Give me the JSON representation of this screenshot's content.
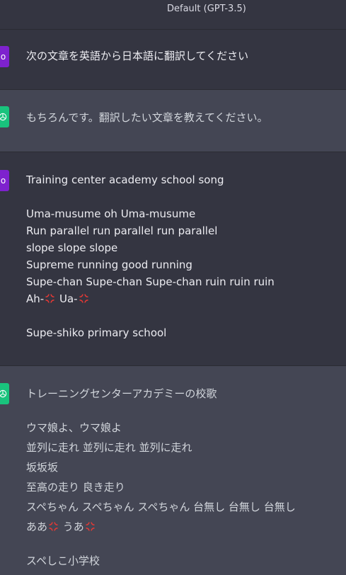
{
  "header": {
    "model_label": "Default (GPT-3.5)"
  },
  "messages": [
    {
      "role": "user",
      "avatar_text": "o",
      "lines": [
        "次の文章を英語から日本語に翻訳してください"
      ]
    },
    {
      "role": "assistant",
      "avatar_icon": "openai-logo-icon",
      "lines": [
        "もちろんです。翻訳したい文章を教えてください。"
      ]
    },
    {
      "role": "user",
      "avatar_text": "o",
      "lines": [
        "Training center academy school song",
        "Uma-musume oh Uma-musume",
        "Run parallel run parallel run parallel",
        "slope slope slope",
        "Supreme running good running",
        "Supe-chan Supe-chan Supe-chan ruin ruin ruin",
        {
          "a": "Ah-",
          "b": "Ua-"
        },
        "Supe-shiko primary school"
      ]
    },
    {
      "role": "assistant",
      "avatar_icon": "openai-logo-icon",
      "lines": [
        "トレーニングセンターアカデミーの校歌",
        "ウマ娘よ、ウマ娘よ",
        "並列に走れ 並列に走れ 並列に走れ",
        "坂坂坂",
        "至高の走り 良き走り",
        "スペちゃん スペちゃん スペちゃん 台無し 台無し 台無し",
        {
          "a": "ああ",
          "b": "うあ"
        },
        "スペしこ小学校"
      ]
    }
  ],
  "colors": {
    "user_bg": "#343541",
    "assistant_bg": "#444654",
    "user_avatar": "#7e22ce",
    "assistant_avatar": "#19c37d",
    "anger_emoji": "#e53935"
  }
}
